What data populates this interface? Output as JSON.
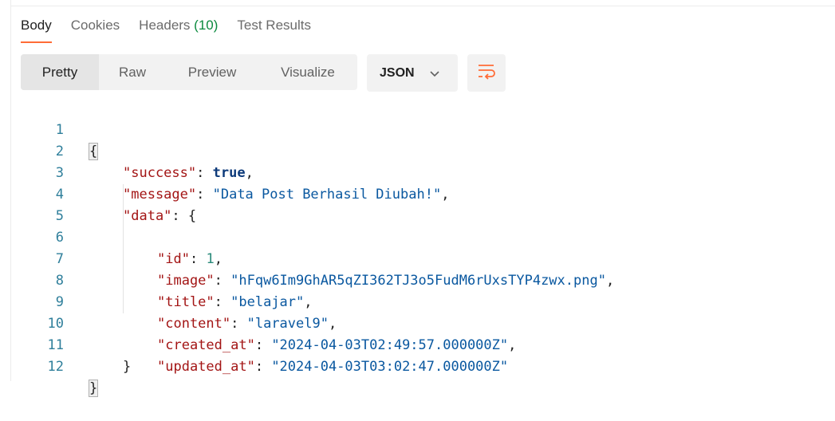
{
  "tabs": [
    {
      "label": "Body"
    },
    {
      "label": "Cookies"
    },
    {
      "label": "Headers",
      "count": "(10)"
    },
    {
      "label": "Test Results"
    }
  ],
  "view_modes": [
    {
      "label": "Pretty"
    },
    {
      "label": "Raw"
    },
    {
      "label": "Preview"
    },
    {
      "label": "Visualize"
    }
  ],
  "format": {
    "selected": "JSON"
  },
  "colors": {
    "accent": "#ff6c37",
    "count": "#0b8a3e",
    "key": "#a31515",
    "string": "#0a58a0",
    "number": "#2a8a7a",
    "keyword": "#0d3a7a"
  },
  "code": {
    "line_numbers": [
      "1",
      "2",
      "3",
      "4",
      "5",
      "6",
      "7",
      "8",
      "9",
      "10",
      "11",
      "12"
    ],
    "tokens": {
      "open_brace": "{",
      "close_brace": "}",
      "colon": ": ",
      "comma": ",",
      "success_key": "\"success\"",
      "success_val": "true",
      "message_key": "\"message\"",
      "message_val": "\"Data Post Berhasil Diubah!\"",
      "data_key": "\"data\"",
      "id_key": "\"id\"",
      "id_val": "1",
      "image_key": "\"image\"",
      "image_val": "\"hFqw6Im9GhAR5qZI362TJ3o5FudM6rUxsTYP4zwx.png\"",
      "title_key": "\"title\"",
      "title_val": "\"belajar\"",
      "content_key": "\"content\"",
      "content_val": "\"laravel9\"",
      "created_key": "\"created_at\"",
      "created_val": "\"2024-04-03T02:49:57.000000Z\"",
      "updated_key": "\"updated_at\"",
      "updated_val": "\"2024-04-03T03:02:47.000000Z\""
    }
  }
}
